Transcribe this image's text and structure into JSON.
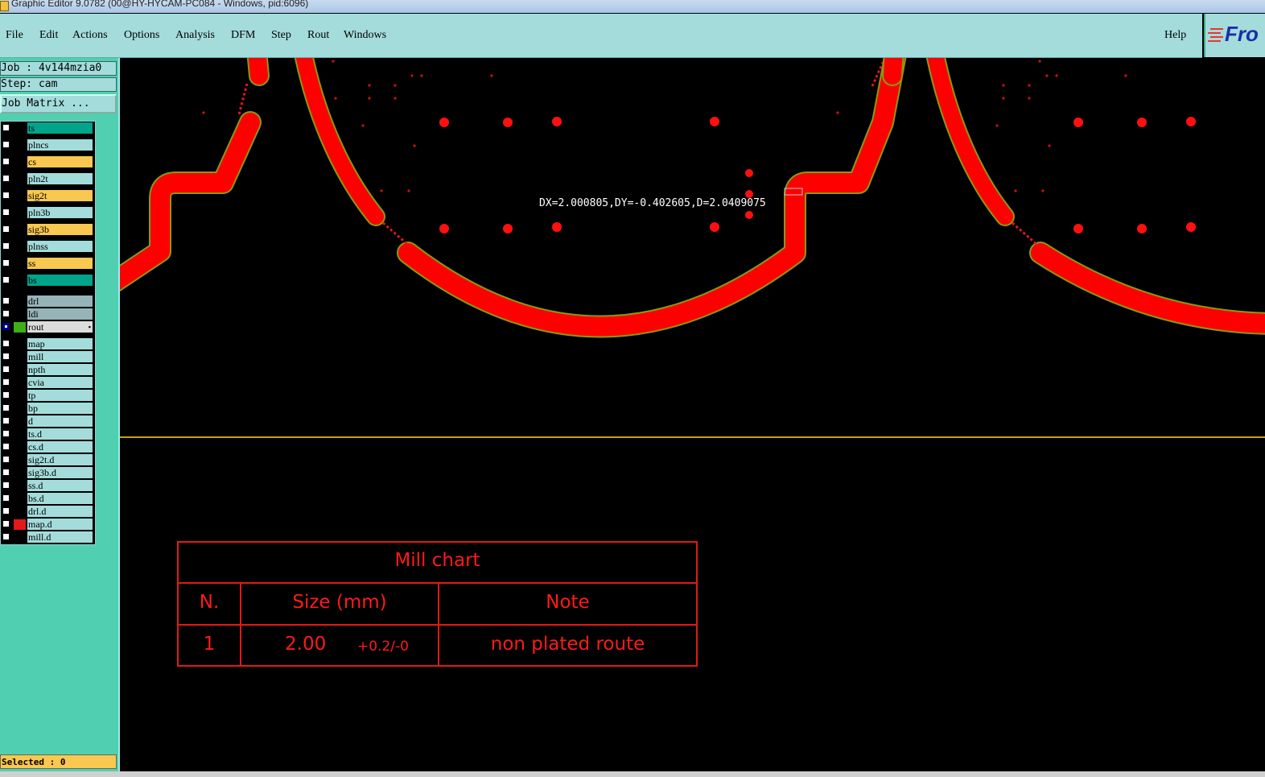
{
  "window": {
    "title": "Graphic Editor 9.0782 (00@HY-HYCAM-PC084 - Windows, pid:6096)"
  },
  "menu": {
    "items": [
      "File",
      "Edit",
      "Actions",
      "Options",
      "Analysis",
      "DFM",
      "Step",
      "Rout",
      "Windows"
    ],
    "help": "Help",
    "logo": "Fro"
  },
  "job": {
    "job_label": "Job : 4v144mzia0",
    "step_label": "Step: cam",
    "matrix_button": "Job Matrix ..."
  },
  "layers": [
    {
      "name": "ts",
      "color": "#00a48a",
      "checked": false,
      "swatch": ""
    },
    {
      "name": "plncs",
      "color": "#a4dcdc",
      "checked": false,
      "swatch": ""
    },
    {
      "name": "cs",
      "color": "#f8c850",
      "checked": false,
      "swatch": ""
    },
    {
      "name": "pln2t",
      "color": "#a4dcdc",
      "checked": false,
      "swatch": ""
    },
    {
      "name": "sig2t",
      "color": "#f8c850",
      "checked": false,
      "swatch": ""
    },
    {
      "name": "pln3b",
      "color": "#a4dcdc",
      "checked": false,
      "swatch": ""
    },
    {
      "name": "sig3b",
      "color": "#f8c850",
      "checked": false,
      "swatch": ""
    },
    {
      "name": "plnss",
      "color": "#a4dcdc",
      "checked": false,
      "swatch": ""
    },
    {
      "name": "ss",
      "color": "#f8c850",
      "checked": false,
      "swatch": ""
    },
    {
      "name": "bs",
      "color": "#00a48a",
      "checked": false,
      "swatch": ""
    },
    {
      "name": "drl",
      "color": "#96b4b8",
      "checked": false,
      "swatch": ""
    },
    {
      "name": "ldi",
      "color": "#96b4b8",
      "checked": false,
      "swatch": ""
    },
    {
      "name": "rout",
      "color": "#dcdcdc",
      "checked": true,
      "swatch": "#3cb014"
    },
    {
      "name": "map",
      "color": "#a4dcdc",
      "checked": false,
      "swatch": ""
    },
    {
      "name": "mill",
      "color": "#a4dcdc",
      "checked": false,
      "swatch": ""
    },
    {
      "name": "npth",
      "color": "#a4dcdc",
      "checked": false,
      "swatch": ""
    },
    {
      "name": "cvia",
      "color": "#a4dcdc",
      "checked": false,
      "swatch": ""
    },
    {
      "name": "tp",
      "color": "#a4dcdc",
      "checked": false,
      "swatch": ""
    },
    {
      "name": "bp",
      "color": "#a4dcdc",
      "checked": false,
      "swatch": ""
    },
    {
      "name": "d",
      "color": "#a4dcdc",
      "checked": false,
      "swatch": ""
    },
    {
      "name": "ts.d",
      "color": "#a4dcdc",
      "checked": false,
      "swatch": ""
    },
    {
      "name": "cs.d",
      "color": "#a4dcdc",
      "checked": false,
      "swatch": ""
    },
    {
      "name": "sig2t.d",
      "color": "#a4dcdc",
      "checked": false,
      "swatch": ""
    },
    {
      "name": "sig3b.d",
      "color": "#a4dcdc",
      "checked": false,
      "swatch": ""
    },
    {
      "name": "ss.d",
      "color": "#a4dcdc",
      "checked": false,
      "swatch": ""
    },
    {
      "name": "bs.d",
      "color": "#a4dcdc",
      "checked": false,
      "swatch": ""
    },
    {
      "name": "drl.d",
      "color": "#a4dcdc",
      "checked": false,
      "swatch": ""
    },
    {
      "name": "map.d",
      "color": "#a4dcdc",
      "checked": false,
      "swatch": "#e41818"
    },
    {
      "name": "mill.d",
      "color": "#a4dcdc",
      "checked": false,
      "swatch": ""
    }
  ],
  "status": {
    "selected": "Selected : 0"
  },
  "measure": {
    "readout": "DX=2.000805,DY=-0.402605,D=2.0409075"
  },
  "mill_chart": {
    "title": "Mill chart",
    "headers": [
      "N.",
      "Size (mm)",
      "Note"
    ],
    "row": {
      "n": "1",
      "size": "2.00",
      "tolerance": "+0.2/-0",
      "note": "non plated route"
    }
  },
  "colors": {
    "copper": "#ff0000",
    "outline": "#8a9a10",
    "board_edge": "#c8a020",
    "chart": "#e41818"
  }
}
